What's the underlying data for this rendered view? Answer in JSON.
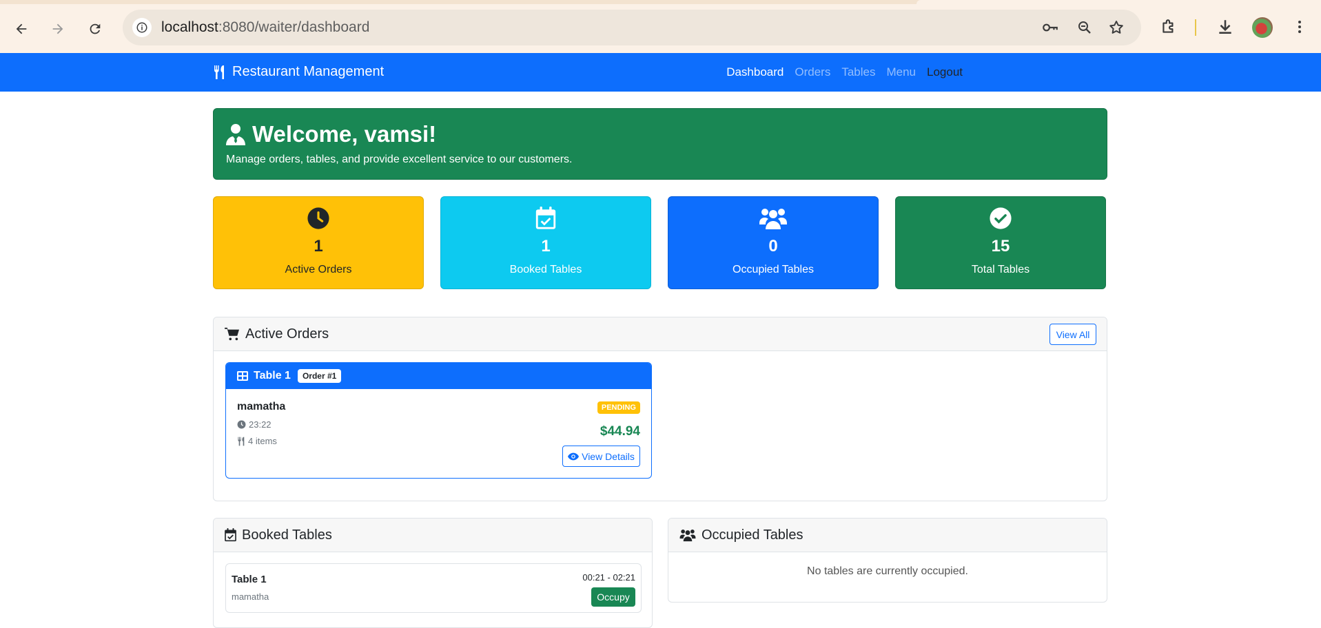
{
  "browser": {
    "url_host": "localhost",
    "url_path": ":8080/waiter/dashboard"
  },
  "navbar": {
    "brand": "Restaurant Management",
    "links": [
      "Dashboard",
      "Orders",
      "Tables",
      "Menu",
      "Logout"
    ]
  },
  "welcome": {
    "title": "Welcome, vamsi!",
    "subtitle": "Manage orders, tables, and provide excellent service to our customers."
  },
  "stats": [
    {
      "value": "1",
      "label": "Active Orders",
      "color": "#ffc107",
      "icon": "clock-icon"
    },
    {
      "value": "1",
      "label": "Booked Tables",
      "color": "#0dcaf0",
      "icon": "calendar-check-icon"
    },
    {
      "value": "0",
      "label": "Occupied Tables",
      "color": "#0d6efd",
      "icon": "users-icon"
    },
    {
      "value": "15",
      "label": "Total Tables",
      "color": "#198754",
      "icon": "check-circle-icon"
    }
  ],
  "active_orders": {
    "title": "Active Orders",
    "view_all": "View All",
    "orders": [
      {
        "table": "Table 1",
        "order_no": "Order #1",
        "customer": "mamatha",
        "time": "23:22",
        "items": "4 items",
        "status": "PENDING",
        "total": "$44.94",
        "action": "View Details"
      }
    ]
  },
  "booked_tables": {
    "title": "Booked Tables",
    "items": [
      {
        "table": "Table 1",
        "customer": "mamatha",
        "time_range": "00:21 - 02:21",
        "action": "Occupy"
      }
    ]
  },
  "occupied_tables": {
    "title": "Occupied Tables",
    "empty_text": "No tables are currently occupied."
  }
}
